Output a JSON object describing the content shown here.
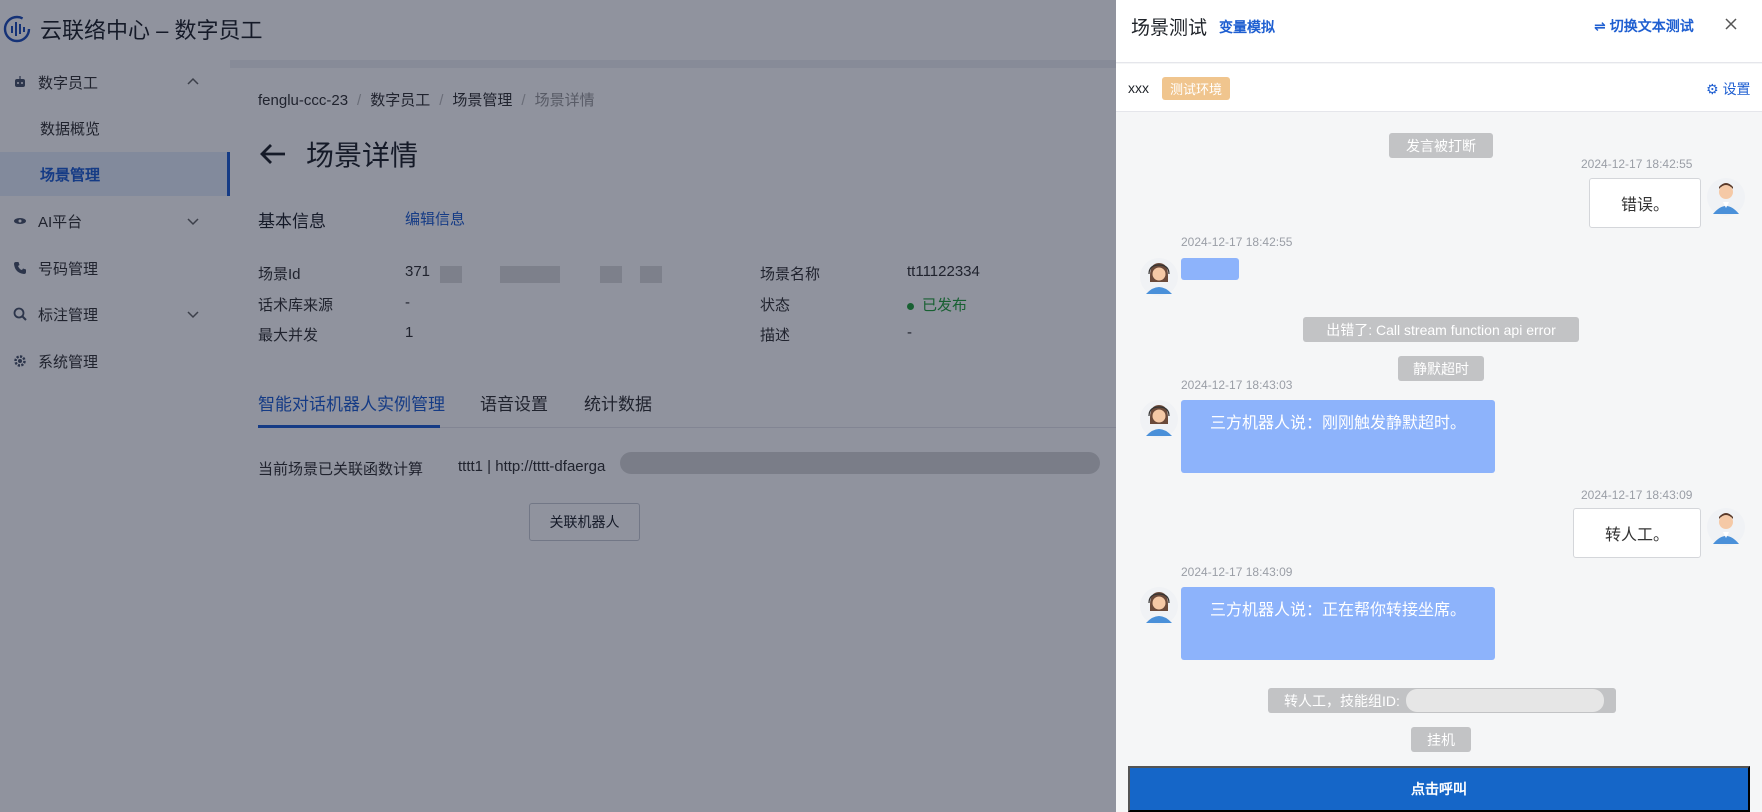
{
  "app": {
    "title": "云联络中心 – 数字员工"
  },
  "sidebar": {
    "items": [
      {
        "label": "数字员工",
        "icon": "robot-icon"
      },
      {
        "label": "数据概览"
      },
      {
        "label": "场景管理"
      },
      {
        "label": "AI平台",
        "icon": "ai-icon"
      },
      {
        "label": "号码管理",
        "icon": "phone-icon"
      },
      {
        "label": "标注管理",
        "icon": "tag-icon"
      },
      {
        "label": "系统管理",
        "icon": "gear-icon"
      }
    ]
  },
  "breadcrumb": [
    "fenglu-ccc-23",
    "数字员工",
    "场景管理",
    "场景详情"
  ],
  "page": {
    "title": "场景详情"
  },
  "basic_info": {
    "title": "基本信息",
    "edit": "编辑信息",
    "scene_id_label": "场景Id",
    "scene_id_value": "371",
    "source_label": "话术库来源",
    "source_value": "-",
    "max_label": "最大并发",
    "max_value": "1",
    "name_label": "场景名称",
    "name_value": "tt11122334",
    "status_label": "状态",
    "status_value": "已发布",
    "desc_label": "描述",
    "desc_value": "-"
  },
  "tabs": [
    "智能对话机器人实例管理",
    "语音设置",
    "统计数据"
  ],
  "function_link": {
    "label": "当前场景已关联函数计算",
    "value": "tttt1 | http://tttt-dfaerga"
  },
  "link_button": "关联机器人",
  "panel": {
    "title": "场景测试",
    "variable_sim": "变量模拟",
    "switch_text": "切换文本测试",
    "robot_name": "xxx",
    "env_tag": "测试环境",
    "settings": "设置",
    "call_button": "点击呼叫"
  },
  "chat": {
    "sys_interrupted": "发言被打断",
    "ts1": "2024-12-17 18:42:55",
    "user1": "错误。",
    "ts2": "2024-12-17 18:42:55",
    "sys_error": "出错了: Call stream function api error",
    "sys_timeout": "静默超时",
    "ts3": "2024-12-17 18:43:03",
    "bot1": "三方机器人说：刚刚触发静默超时。",
    "ts4": "2024-12-17 18:43:09",
    "user2": "转人工。",
    "ts5": "2024-12-17 18:43:09",
    "bot2": "三方机器人说：正在帮你转接坐席。",
    "sys_transfer": "转人工，技能组ID:",
    "sys_hangup": "挂机"
  },
  "colors": {
    "accent": "#1f5fd1",
    "bot_bubble": "#8db3fb",
    "call_button": "#1566c8",
    "env_tag": "#f0c58e",
    "status_green": "#26a33b"
  }
}
